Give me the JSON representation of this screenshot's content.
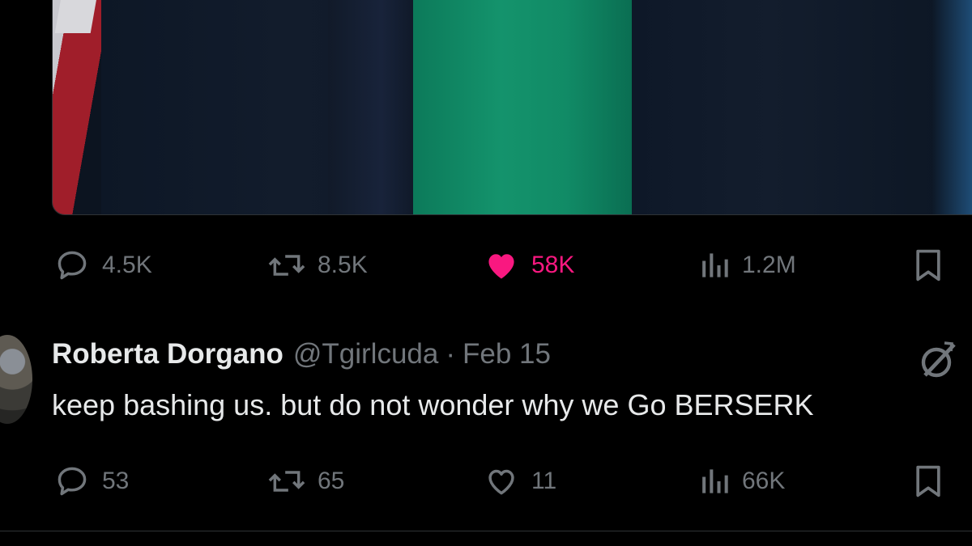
{
  "tweet": {
    "stats": {
      "replies": "4.5K",
      "reposts": "8.5K",
      "likes": "58K",
      "views": "1.2M"
    },
    "liked": true,
    "accent_color": "#f91880"
  },
  "reply": {
    "author_name": "Roberta Dorgano",
    "handle": "@Tgirlcuda",
    "separator": "·",
    "date": "Feb 15",
    "text": "keep bashing us. but do not wonder why we Go BERSERK",
    "stats": {
      "replies": "53",
      "reposts": "65",
      "likes": "11",
      "views": "66K"
    }
  },
  "icons": {
    "reply": "speech-bubble-icon",
    "repost": "repost-arrows-icon",
    "like": "heart-icon",
    "views": "bar-chart-icon",
    "bookmark": "bookmark-icon",
    "grok": "grok-slash-circle-icon"
  },
  "colors": {
    "background": "#000000",
    "text_primary": "#e7e9ea",
    "text_secondary": "#71767b",
    "like": "#f91880"
  }
}
